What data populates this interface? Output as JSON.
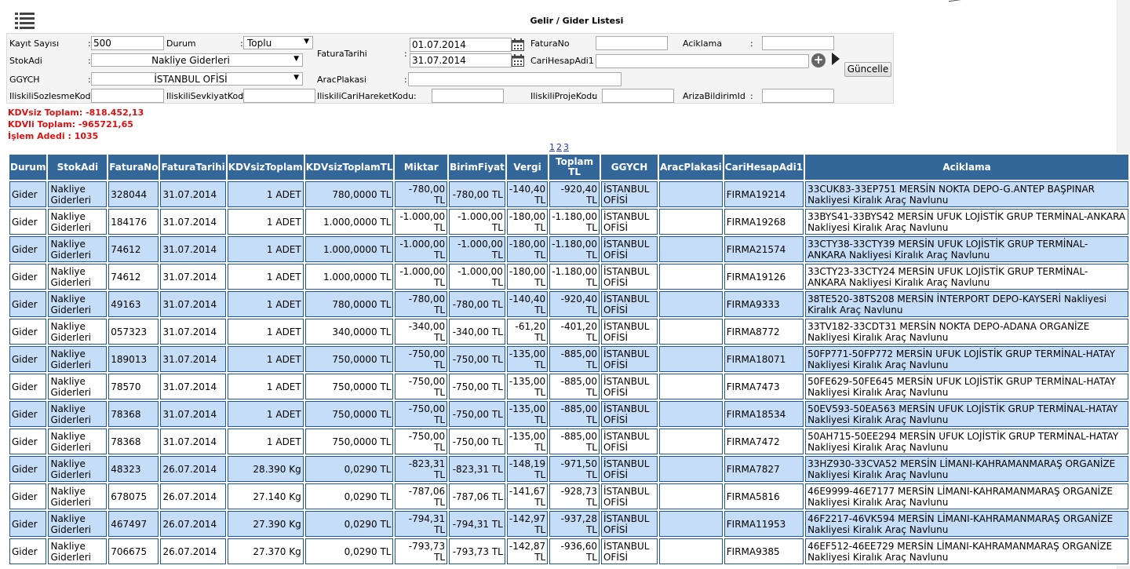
{
  "page": {
    "title": "Gelir / Gider Listesi"
  },
  "filters": {
    "kayit_sayisi": {
      "label": "Kayıt Sayısı",
      "value": "500"
    },
    "durum": {
      "label": "Durum",
      "value": "Toplu"
    },
    "stok_adi": {
      "label": "StokAdi",
      "value": "Nakliye Giderleri"
    },
    "ggych": {
      "label": "GGYCH",
      "value": "İSTANBUL OFİSİ"
    },
    "fatura_tarihi": {
      "label": "FaturaTarihi",
      "start": "01.07.2014",
      "end": "31.07.2014"
    },
    "fatura_no": {
      "label": "FaturaNo",
      "value": ""
    },
    "aciklama": {
      "label": "Aciklama",
      "value": ""
    },
    "cari_hesap_adi": {
      "label": "CariHesapAdi1",
      "value": ""
    },
    "arac_plakasi": {
      "label": "AracPlakasi",
      "value": ""
    },
    "iliskili_sozlesme": {
      "label": "IliskiliSozlesmeKodu",
      "value": ""
    },
    "iliskili_sevkiyat": {
      "label": "IliskiliSevkiyatKodu",
      "value": ""
    },
    "iliskili_cari": {
      "label": "IliskiliCariHareketKodu",
      "value": ""
    },
    "iliskili_proje": {
      "label": "IliskiliProjeKodu",
      "value": ""
    },
    "ariza_bildirim": {
      "label": "ArizaBildirimId",
      "value": ""
    },
    "update_button": "Güncelle"
  },
  "summary": {
    "kdvsiz": "KDVsiz Toplam: -818.452,13",
    "kdvli": "KDVli Toplam: -965721,65",
    "islem": "İşlem Adedi : 1035"
  },
  "pager": [
    "1",
    "2",
    "3"
  ],
  "table": {
    "headers": [
      "Durum",
      "StokAdi",
      "FaturaNo",
      "FaturaTarihi",
      "KDVsizToplam",
      "KDVsizToplamTL",
      "Miktar",
      "BirimFiyat",
      "Vergi",
      "Toplam TL",
      "GGYCH",
      "AracPlakasi",
      "CariHesapAdi1",
      "Aciklama"
    ],
    "rows": [
      [
        "Gider",
        "Nakliye Giderleri",
        "328044",
        "31.07.2014",
        "1 ADET",
        "780,0000 TL",
        "-780,00 TL",
        "-780,00 TL",
        "-140,40 TL",
        "-920,40 TL",
        "İSTANBUL OFİSİ",
        "",
        "FIRMA19214",
        "33CUK83-33EP751 MERSİN NOKTA DEPO-G.ANTEP BAŞPINAR Nakliyesi Kiralık Araç Navlunu"
      ],
      [
        "Gider",
        "Nakliye Giderleri",
        "184176",
        "31.07.2014",
        "1 ADET",
        "1.000,0000 TL",
        "-1.000,00 TL",
        "-1.000,00 TL",
        "-180,00 TL",
        "-1.180,00 TL",
        "İSTANBUL OFİSİ",
        "",
        "FIRMA19268",
        "33BYS41-33BYS42 MERSİN UFUK LOJİSTİK GRUP TERMİNAL-ANKARA Nakliyesi Kiralık Araç Navlunu"
      ],
      [
        "Gider",
        "Nakliye Giderleri",
        "74612",
        "31.07.2014",
        "1 ADET",
        "1.000,0000 TL",
        "-1.000,00 TL",
        "-1.000,00 TL",
        "-180,00 TL",
        "-1.180,00 TL",
        "İSTANBUL OFİSİ",
        "",
        "FIRMA21574",
        "33CTY38-33CTY39 MERSİN UFUK LOJİSTİK GRUP TERMİNAL-ANKARA Nakliyesi Kiralık Araç Navlunu"
      ],
      [
        "Gider",
        "Nakliye Giderleri",
        "74612",
        "31.07.2014",
        "1 ADET",
        "1.000,0000 TL",
        "-1.000,00 TL",
        "-1.000,00 TL",
        "-180,00 TL",
        "-1.180,00 TL",
        "İSTANBUL OFİSİ",
        "",
        "FIRMA19126",
        "33CTY23-33CTY24 MERSİN UFUK LOJİSTİK GRUP TERMİNAL-ANKARA Nakliyesi Kiralık Araç Navlunu"
      ],
      [
        "Gider",
        "Nakliye Giderleri",
        "49163",
        "31.07.2014",
        "1 ADET",
        "780,0000 TL",
        "-780,00 TL",
        "-780,00 TL",
        "-140,40 TL",
        "-920,40 TL",
        "İSTANBUL OFİSİ",
        "",
        "FIRMA9333",
        "38TE520-38TS208 MERSİN İNTERPORT DEPO-KAYSERİ Nakliyesi Kiralık Araç Navlunu"
      ],
      [
        "Gider",
        "Nakliye Giderleri",
        "057323",
        "31.07.2014",
        "1 ADET",
        "340,0000 TL",
        "-340,00 TL",
        "-340,00 TL",
        "-61,20 TL",
        "-401,20 TL",
        "İSTANBUL OFİSİ",
        "",
        "FIRMA8772",
        "33TV182-33CDT31 MERSİN NOKTA DEPO-ADANA ORGANİZE Nakliyesi Kiralık Araç Navlunu"
      ],
      [
        "Gider",
        "Nakliye Giderleri",
        "189013",
        "31.07.2014",
        "1 ADET",
        "750,0000 TL",
        "-750,00 TL",
        "-750,00 TL",
        "-135,00 TL",
        "-885,00 TL",
        "İSTANBUL OFİSİ",
        "",
        "FIRMA18071",
        "50FP771-50FP772 MERSİN UFUK LOJİSTİK GRUP TERMİNAL-HATAY Nakliyesi Kiralık Araç Navlunu"
      ],
      [
        "Gider",
        "Nakliye Giderleri",
        "78570",
        "31.07.2014",
        "1 ADET",
        "750,0000 TL",
        "-750,00 TL",
        "-750,00 TL",
        "-135,00 TL",
        "-885,00 TL",
        "İSTANBUL OFİSİ",
        "",
        "FIRMA7473",
        "50FE629-50FE645 MERSİN UFUK LOJİSTİK GRUP TERMİNAL-HATAY Nakliyesi Kiralık Araç Navlunu"
      ],
      [
        "Gider",
        "Nakliye Giderleri",
        "78368",
        "31.07.2014",
        "1 ADET",
        "750,0000 TL",
        "-750,00 TL",
        "-750,00 TL",
        "-135,00 TL",
        "-885,00 TL",
        "İSTANBUL OFİSİ",
        "",
        "FIRMA18534",
        "50EV593-50EA563 MERSİN UFUK LOJİSTİK GRUP TERMİNAL-HATAY Nakliyesi Kiralık Araç Navlunu"
      ],
      [
        "Gider",
        "Nakliye Giderleri",
        "78368",
        "31.07.2014",
        "1 ADET",
        "750,0000 TL",
        "-750,00 TL",
        "-750,00 TL",
        "-135,00 TL",
        "-885,00 TL",
        "İSTANBUL OFİSİ",
        "",
        "FIRMA7472",
        "50AH715-50EE294 MERSİN UFUK LOJİSTİK GRUP TERMİNAL-HATAY Nakliyesi Kiralık Araç Navlunu"
      ],
      [
        "Gider",
        "Nakliye Giderleri",
        "48323",
        "26.07.2014",
        "28.390 Kg",
        "0,0290 TL",
        "-823,31 TL",
        "-823,31 TL",
        "-148,19 TL",
        "-971,50 TL",
        "İSTANBUL OFİSİ",
        "",
        "FIRMA7827",
        "33HZ930-33CVA52 MERSİN LİMANI-KAHRAMANMARAŞ ORGANİZE Nakliyesi Kiralık Araç Navlunu"
      ],
      [
        "Gider",
        "Nakliye Giderleri",
        "678075",
        "26.07.2014",
        "27.140 Kg",
        "0,0290 TL",
        "-787,06 TL",
        "-787,06 TL",
        "-141,67 TL",
        "-928,73 TL",
        "İSTANBUL OFİSİ",
        "",
        "FIRMA5816",
        "46E9999-46E7177 MERSİN LİMANI-KAHRAMANMARAŞ ORGANİZE Nakliyesi Kiralık Araç Navlunu"
      ],
      [
        "Gider",
        "Nakliye Giderleri",
        "467497",
        "26.07.2014",
        "27.390 Kg",
        "0,0290 TL",
        "-794,31 TL",
        "-794,31 TL",
        "-142,97 TL",
        "-937,28 TL",
        "İSTANBUL OFİSİ",
        "",
        "FIRMA11953",
        "46F2217-46VK594 MERSİN LİMANI-KAHRAMANMARAŞ ORGANİZE Nakliyesi Kiralık Araç Navlunu"
      ],
      [
        "Gider",
        "Nakliye Giderleri",
        "706675",
        "26.07.2014",
        "27.370 Kg",
        "0,0290 TL",
        "-793,73 TL",
        "-793,73 TL",
        "-142,87 TL",
        "-936,60 TL",
        "İSTANBUL OFİSİ",
        "",
        "FIRMA9385",
        "46EF512-46EE729 MERSİN LİMANI-KAHRAMANMARAŞ ORGANİZE Nakliyesi Kiralık Araç Navlunu"
      ]
    ]
  },
  "colors": {
    "header_bg": "#336699",
    "row_alt_bg": "#c5ddf7",
    "summary_text": "#dd1111",
    "link": "#1a33cc"
  }
}
